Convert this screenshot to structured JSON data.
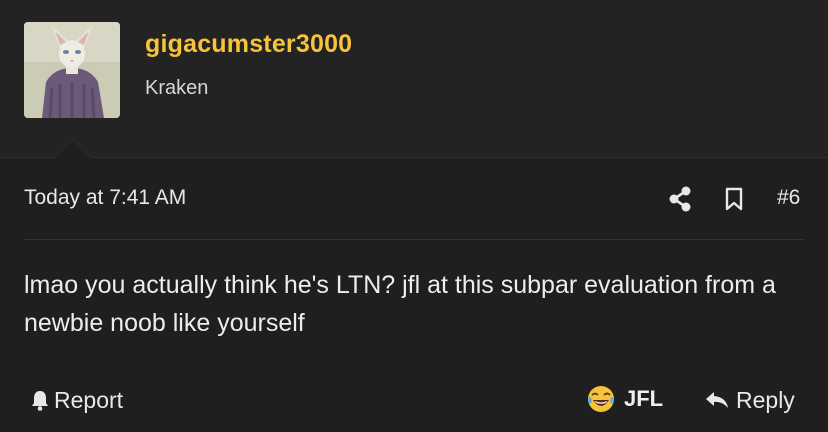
{
  "post": {
    "author": {
      "username": "gigacumster3000",
      "title": "Kraken",
      "avatar_icon": "cat-avatar"
    },
    "timestamp": "Today at 7:41 AM",
    "post_number": "#6",
    "message": "lmao you actually think he's LTN? jfl at this subpar evaluation from a newbie noob like yourself",
    "actions": {
      "report_label": "Report",
      "reaction_label": "JFL",
      "reply_label": "Reply"
    }
  },
  "colors": {
    "background": "#1f1f1f",
    "header_background": "#232323",
    "username": "#f7c33a",
    "text": "#e8e8e8"
  },
  "icons": [
    "share-icon",
    "bookmark-icon",
    "bell-icon",
    "crying-laughing-emoji-icon",
    "reply-arrow-icon"
  ]
}
